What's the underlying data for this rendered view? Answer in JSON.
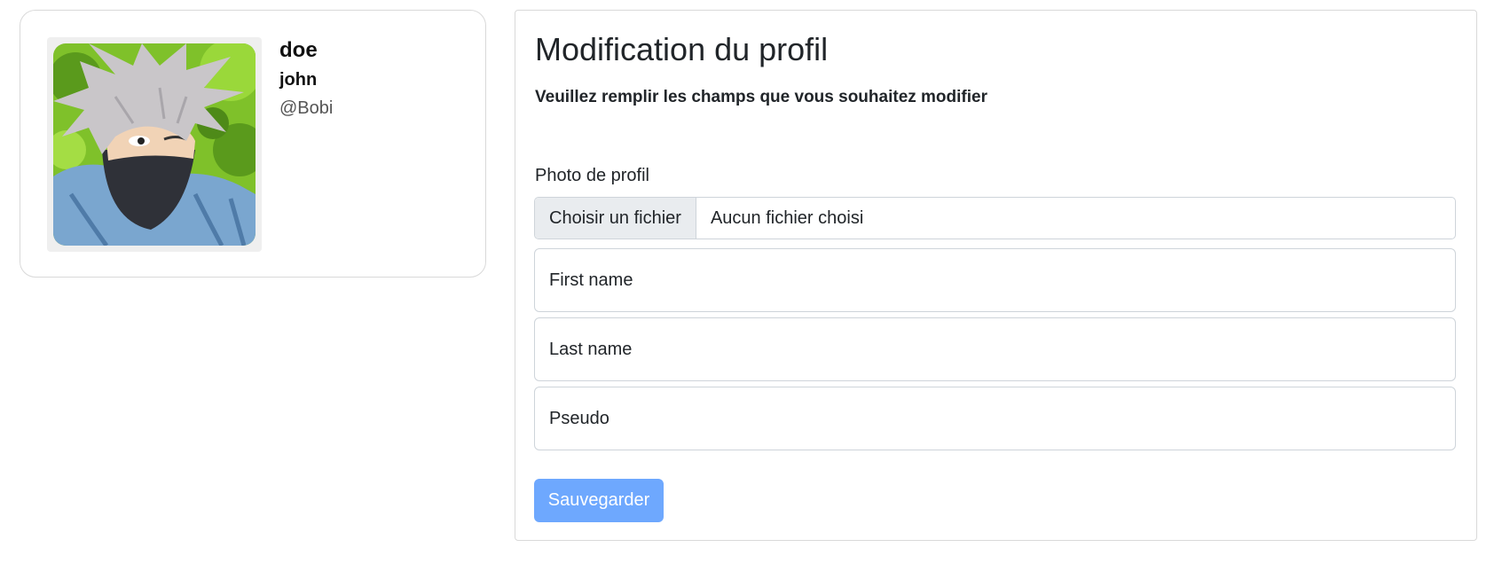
{
  "profile": {
    "last_name": "doe",
    "first_name": "john",
    "handle": "@Bobi"
  },
  "edit_form": {
    "title": "Modification du profil",
    "subtitle": "Veuillez remplir les champs que vous souhaitez modifier",
    "photo_label": "Photo de profil",
    "file_button_label": "Choisir un fichier",
    "file_status": "Aucun fichier choisi",
    "first_name_placeholder": "First name",
    "last_name_placeholder": "Last name",
    "pseudo_placeholder": "Pseudo",
    "save_label": "Sauvegarder"
  },
  "colors": {
    "save_button": "#6ea8fe",
    "border": "#ced4da",
    "file_button_bg": "#e9ecef"
  }
}
